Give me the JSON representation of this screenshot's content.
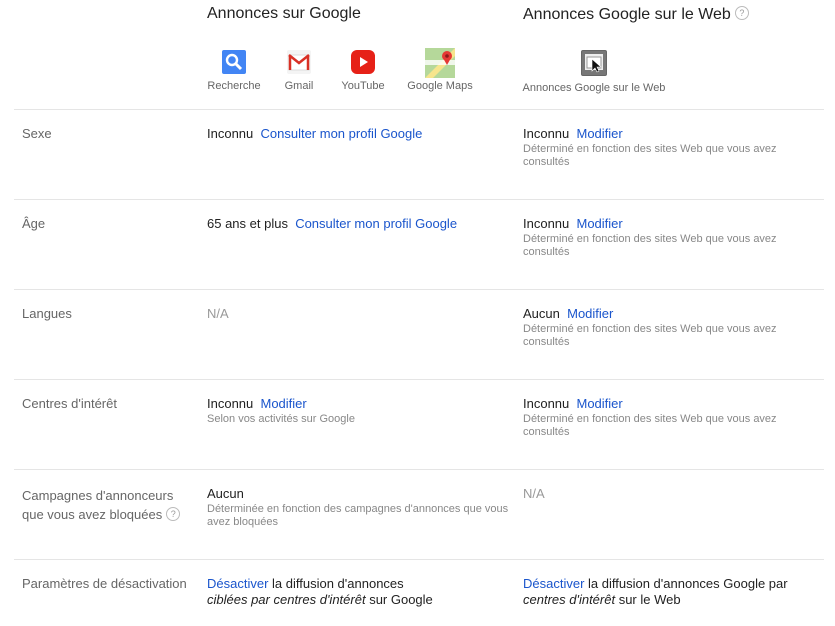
{
  "columns": {
    "google_title": "Annonces sur Google",
    "web_title": "Annonces Google sur le Web",
    "help_glyph": "?"
  },
  "products": [
    {
      "label": "Recherche",
      "icon": "search-icon"
    },
    {
      "label": "Gmail",
      "icon": "gmail-icon"
    },
    {
      "label": "YouTube",
      "icon": "youtube-icon"
    },
    {
      "label": "Google Maps",
      "icon": "maps-icon"
    }
  ],
  "web_product": {
    "label": "Annonces Google sur le Web",
    "icon": "web-ads-icon"
  },
  "rows": {
    "sexe": {
      "label": "Sexe",
      "google_value": "Inconnu",
      "google_link": "Consulter mon profil Google",
      "web_value": "Inconnu",
      "web_link": "Modifier",
      "web_note": "Déterminé en fonction des sites Web que vous avez consultés"
    },
    "age": {
      "label": "Âge",
      "google_value": "65 ans et plus",
      "google_link": "Consulter mon profil Google",
      "web_value": "Inconnu",
      "web_link": "Modifier",
      "web_note": "Déterminé en fonction des sites Web que vous avez consultés"
    },
    "langues": {
      "label": "Langues",
      "google_na": "N/A",
      "web_value": "Aucun",
      "web_link": "Modifier",
      "web_note": "Déterminé en fonction des sites Web que vous avez consultés"
    },
    "interets": {
      "label": "Centres d'intérêt",
      "google_value": "Inconnu",
      "google_link": "Modifier",
      "google_note": "Selon vos activités sur Google",
      "web_value": "Inconnu",
      "web_link": "Modifier",
      "web_note": "Déterminé en fonction des sites Web que vous avez consultés"
    },
    "campagnes": {
      "label_line1": "Campagnes d'annonceurs",
      "label_line2": "que vous avez bloquées",
      "google_value": "Aucun",
      "google_note": "Déterminée en fonction des campagnes d'annonces que vous avez bloquées",
      "web_na": "N/A"
    },
    "desactivation": {
      "label": "Paramètres de désactivation",
      "google_link": "Désactiver",
      "google_text1": " la diffusion d'annonces",
      "google_em": "ciblées par centres d'intérêt",
      "google_text2": " sur Google",
      "web_link": "Désactiver",
      "web_text1": " la diffusion d'annonces Google par",
      "web_em": "centres d'intérêt",
      "web_text2": " sur le Web"
    }
  }
}
